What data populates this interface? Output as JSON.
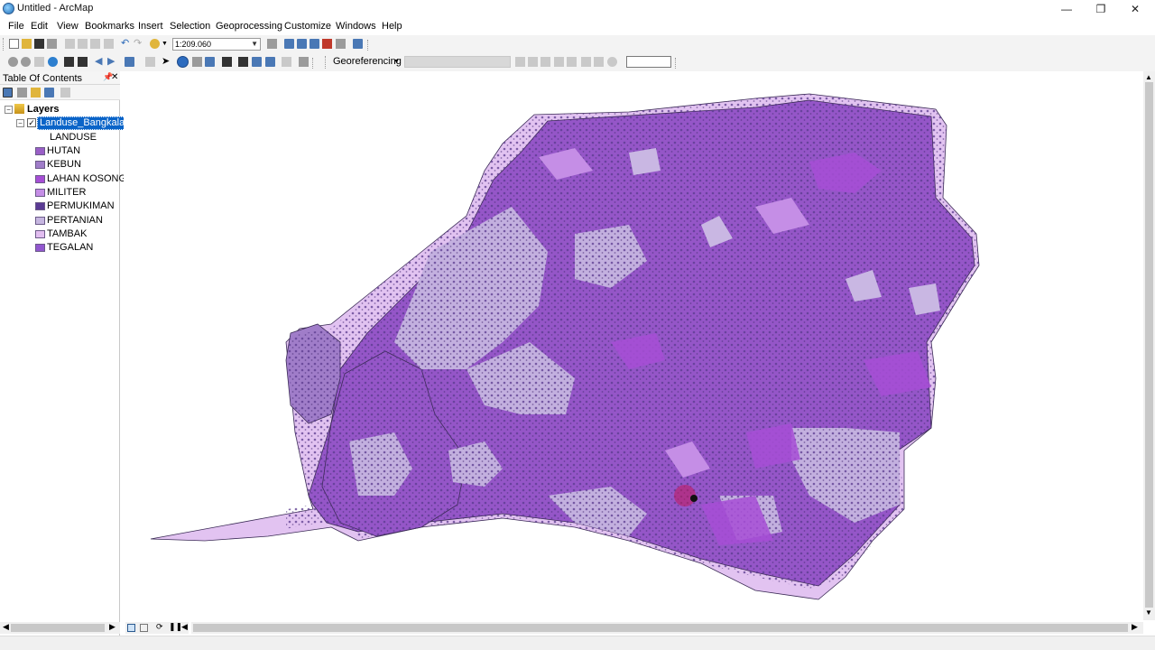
{
  "window": {
    "title": "Untitled - ArcMap"
  },
  "menu": [
    "File",
    "Edit",
    "View",
    "Bookmarks",
    "Insert",
    "Selection",
    "Geoprocessing",
    "Customize",
    "Windows",
    "Help"
  ],
  "standard_toolbar": {
    "scale_value": "1:209.060"
  },
  "georef_toolbar": {
    "label": "Georeferencing",
    "layer_combo": "",
    "input": ""
  },
  "toc": {
    "title": "Table Of Contents",
    "root_label": "Layers",
    "layer_name": "Landuse_Bangkalan",
    "field_heading": "LANDUSE",
    "classes": [
      {
        "label": "HUTAN",
        "color": "#9a5fc7"
      },
      {
        "label": "KEBUN",
        "color": "#a07dc9"
      },
      {
        "label": "LAHAN KOSONG",
        "color": "#a74ed6"
      },
      {
        "label": "MILITER",
        "color": "#c58ee6"
      },
      {
        "label": "PERMUKIMAN",
        "color": "#5a3a94"
      },
      {
        "label": "PERTANIAN",
        "color": "#c6b6e0"
      },
      {
        "label": "TAMBAK",
        "color": "#e2bef0"
      },
      {
        "label": "TEGALAN",
        "color": "#9257cf"
      }
    ]
  },
  "colors": {
    "accent": "#0a64c8",
    "map_main": "#9556c8",
    "map_light": "#c3b0df",
    "map_coast": "#e2c3f1",
    "map_dark": "#5b3a8e"
  }
}
